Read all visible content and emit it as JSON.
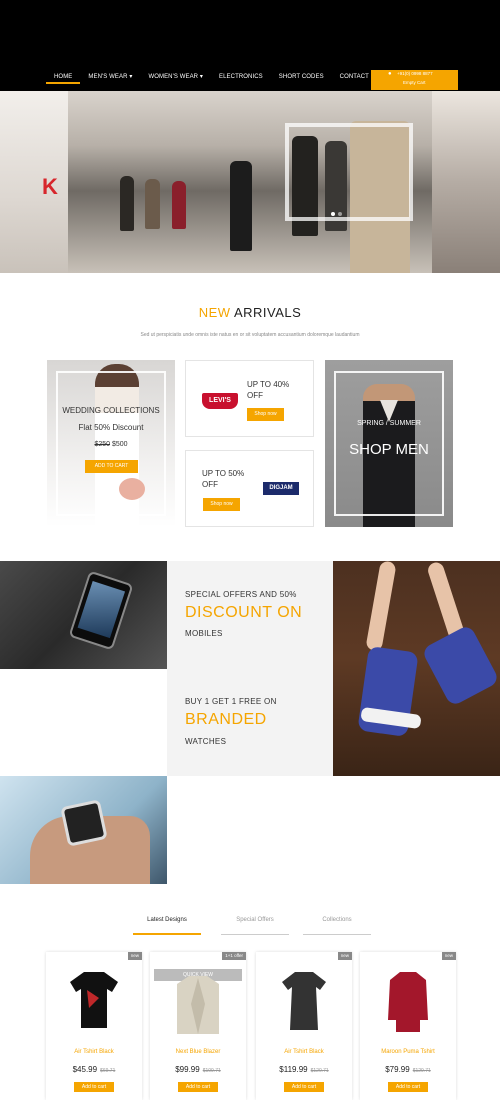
{
  "nav": {
    "items": [
      "HOME",
      "MEN'S WEAR ▾",
      "WOMEN'S WEAR ▾",
      "ELECTRONICS",
      "SHORT CODES",
      "CONTACT"
    ],
    "active": "HOME"
  },
  "cart": {
    "phone": "+91(0) 0998 8877",
    "label": "Empty Cart"
  },
  "new_arrivals": {
    "title_highlight": "NEW",
    "title_rest": "ARRIVALS",
    "subtitle": "Sed ut perspiciatis unde omnis iste natus en or sit voluptatem accusantium doloremque laudantium"
  },
  "wedding": {
    "heading": "WEDDING COLLECTIONS",
    "discount": "Flat 50% Discount",
    "old_price": "$250",
    "new_price": "$500",
    "button": "ADD TO CART"
  },
  "levis_card": {
    "offer_line1": "UP TO 40%",
    "offer_line2": "OFF",
    "brand": "LEVI'S",
    "button": "Shop now"
  },
  "digjam_card": {
    "offer_line1": "UP TO 50%",
    "offer_line2": "OFF",
    "brand": "DIGJAM",
    "button": "Shop now"
  },
  "men_card": {
    "line1": "SPRING / SUMMER",
    "line2": "SHOP MEN"
  },
  "promo": {
    "mobile_line1": "SPECIAL OFFERS AND 50%",
    "mobile_big": "DISCOUNT ON",
    "mobile_line3": "MOBILES",
    "watch_line1": "BUY 1 GET 1 FREE ON",
    "watch_big": "BRANDED",
    "watch_line3": "WATCHES"
  },
  "tabs": [
    "Latest Designs",
    "Special Offers",
    "Collections"
  ],
  "products": [
    {
      "name": "Air Tshirt Black",
      "price": "$45.99",
      "old_price": "$69.71",
      "badge": "new",
      "button": "Add to cart",
      "color": "#111111",
      "type": "tshirt"
    },
    {
      "name": "Next Blue Blazer",
      "price": "$99.99",
      "old_price": "$109.71",
      "badge": "1+1 offer",
      "button": "Add to cart",
      "quick_view": "QUICK VIEW",
      "color": "#d9d3c3",
      "type": "blazer"
    },
    {
      "name": "Air Tshirt Black",
      "price": "$119.99",
      "old_price": "$120.71",
      "badge": "new",
      "button": "Add to cart",
      "color": "#333333",
      "type": "tshirt"
    },
    {
      "name": "Maroon Puma Tshirt",
      "price": "$79.99",
      "old_price": "$129.71",
      "badge": "new",
      "button": "Add to cart",
      "color": "#a3172b",
      "type": "top"
    }
  ],
  "colors": {
    "accent": "#f5a500",
    "topbar": "#000000",
    "promo_bg": "#f3f3f3"
  }
}
